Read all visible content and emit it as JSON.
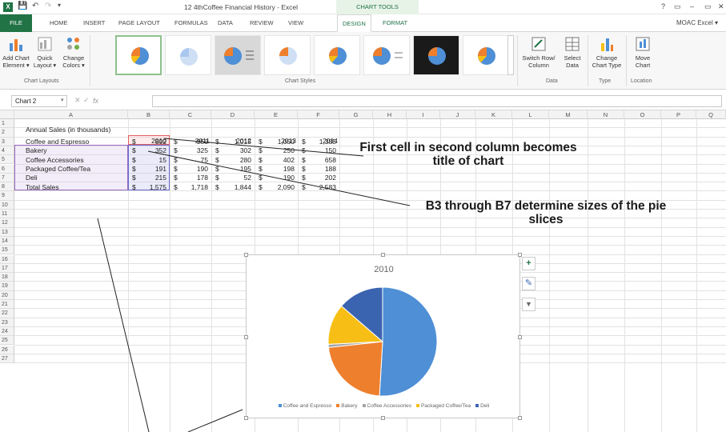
{
  "title_bar": {
    "doc_title": "12 4thCoffee Financial History - Excel",
    "chart_tools": "CHART TOOLS",
    "help": "?",
    "minimize": "–",
    "restore": "▭",
    "close": "✕"
  },
  "tabs": [
    "FILE",
    "HOME",
    "INSERT",
    "PAGE LAYOUT",
    "FORMULAS",
    "DATA",
    "REVIEW",
    "VIEW",
    "DESIGN",
    "FORMAT"
  ],
  "active_tab": "DESIGN",
  "user": "MOAC Excel ▾",
  "ribbon": {
    "add_chart_element": "Add Chart Element ▾",
    "quick_layout": "Quick Layout ▾",
    "change_colors": "Change Colors ▾",
    "group_chart_layouts": "Chart Layouts",
    "group_chart_styles": "Chart Styles",
    "switch_row_column": "Switch Row/ Column",
    "select_data": "Select Data",
    "group_data": "Data",
    "change_chart_type": "Change Chart Type",
    "group_type": "Type",
    "move_chart": "Move Chart",
    "group_location": "Location"
  },
  "formula_bar": {
    "name_box": "Chart 2",
    "fx": "fx",
    "value": ""
  },
  "columns": [
    "A",
    "B",
    "C",
    "D",
    "E",
    "F",
    "G",
    "H",
    "I",
    "J",
    "K",
    "L",
    "M",
    "N",
    "O",
    "P",
    "Q"
  ],
  "rows": [
    "1",
    "2",
    "3",
    "4",
    "5",
    "6",
    "7",
    "8",
    "9",
    "10",
    "11",
    "12",
    "13",
    "14",
    "15",
    "16",
    "17",
    "18",
    "19",
    "20",
    "21",
    "22",
    "23",
    "24",
    "25",
    "26",
    "27"
  ],
  "sheet": {
    "a1": "Annual Sales (in thousands)",
    "years": [
      "2010",
      "2011",
      "2012",
      "2013",
      "2014"
    ],
    "currency": "$",
    "rows": [
      {
        "label": "Coffee and Espresso",
        "values": [
          "802",
          "950",
          "1,015",
          "1,050",
          "1,385"
        ]
      },
      {
        "label": "Bakery",
        "values": [
          "352",
          "325",
          "302",
          "250",
          "150"
        ]
      },
      {
        "label": "Coffee Accessories",
        "values": [
          "15",
          "75",
          "280",
          "402",
          "658"
        ]
      },
      {
        "label": "Packaged Coffee/Tea",
        "values": [
          "191",
          "190",
          "195",
          "198",
          "188"
        ]
      },
      {
        "label": "Deli",
        "values": [
          "215",
          "178",
          "52",
          "190",
          "202"
        ]
      }
    ],
    "total": {
      "label": "Total Sales",
      "values": [
        "1,575",
        "1,718",
        "1,844",
        "2,090",
        "2,583"
      ]
    }
  },
  "chart_data": {
    "type": "pie",
    "title": "2010",
    "categories": [
      "Coffee and Espresso",
      "Bakery",
      "Coffee Accessories",
      "Packaged Coffee/Tea",
      "Deli"
    ],
    "values": [
      802,
      352,
      15,
      191,
      215
    ],
    "colors": [
      "#4e8fd6",
      "#ee7f2d",
      "#a5a5a5",
      "#f7bf16",
      "#3b64b0"
    ],
    "legend": "bottom"
  },
  "chart_buttons": [
    "+",
    "✎",
    "▼"
  ],
  "annotations": {
    "title_note": "First cell in second column becomes title of chart",
    "slices_note": "B3 through B7 determine sizes of the pie slices"
  },
  "style_thumb_colors": [
    "#4e8fd6",
    "#ee7f2d",
    "#a5a5a5",
    "#f7bf16"
  ]
}
